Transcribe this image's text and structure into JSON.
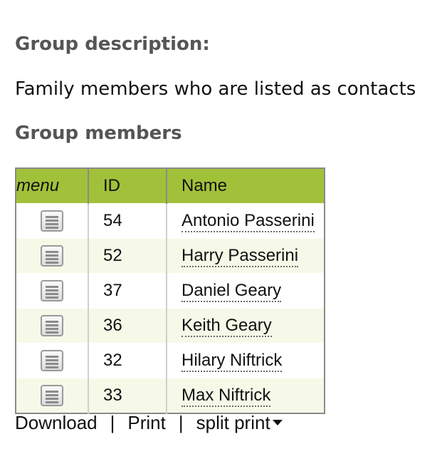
{
  "group": {
    "description_heading": "Group description:",
    "description": "Family members who are listed as contacts",
    "members_heading": "Group members"
  },
  "table": {
    "columns": [
      "menu",
      "ID",
      "Name"
    ],
    "rows": [
      {
        "id": "54",
        "name": "Antonio Passerini"
      },
      {
        "id": "52",
        "name": "Harry Passerini"
      },
      {
        "id": "37",
        "name": "Daniel Geary"
      },
      {
        "id": "36",
        "name": "Keith Geary"
      },
      {
        "id": "32",
        "name": "Hilary Niftrick"
      },
      {
        "id": "33",
        "name": "Max Niftrick"
      }
    ]
  },
  "footer": {
    "download": "Download",
    "print": "Print",
    "split_print": "split print",
    "separator": "|"
  },
  "colors": {
    "header_bg": "#a2c13a",
    "alt_row_bg": "#f6f9e8",
    "heading_text": "#555555"
  },
  "icons": {
    "row_menu": "menu-icon",
    "split_print_dropdown": "caret-down-icon"
  }
}
